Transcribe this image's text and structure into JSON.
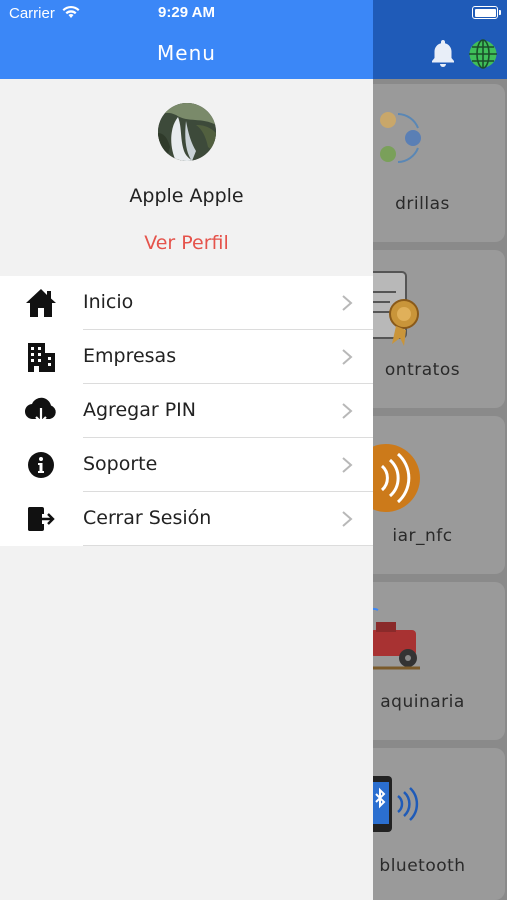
{
  "status_bar": {
    "carrier": "Carrier",
    "time": "9:29 AM"
  },
  "drawer": {
    "title": "Menu",
    "user_name": "Apple Apple",
    "profile_link": "Ver Perfil",
    "items": [
      {
        "label": "Inicio",
        "icon": "home-icon"
      },
      {
        "label": "Empresas",
        "icon": "building-icon"
      },
      {
        "label": "Agregar PIN",
        "icon": "cloud-download-icon"
      },
      {
        "label": "Soporte",
        "icon": "info-icon"
      },
      {
        "label": "Cerrar Sesión",
        "icon": "logout-icon"
      }
    ]
  },
  "background": {
    "cards": [
      {
        "label": "drillas"
      },
      {
        "label": "ontratos"
      },
      {
        "label": "iar_nfc"
      },
      {
        "label": "aquinaria"
      },
      {
        "label": "bluetooth"
      }
    ]
  },
  "colors": {
    "header_blue": "#3b87f7",
    "bg_header_blue": "#1f5bb8",
    "link_red": "#e5534b",
    "drawer_bg": "#f2f2f2"
  }
}
